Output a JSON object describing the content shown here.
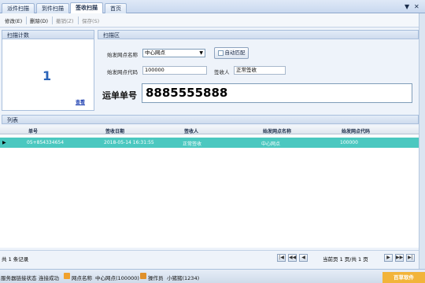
{
  "tabs": [
    {
      "label": "派件扫描"
    },
    {
      "label": "到件扫描"
    },
    {
      "label": "签收扫描"
    },
    {
      "label": "首页"
    }
  ],
  "tab_controls": {
    "down": "▼",
    "close": "✕"
  },
  "toolbar": {
    "edit": "修改(E)",
    "delete": "删除(D)",
    "undo": "撤销(Z)",
    "save": "保存(S)"
  },
  "count_panel": {
    "title": "扫描计数",
    "count": "1",
    "view_link": "查看"
  },
  "scan_panel": {
    "title": "扫描区",
    "origin_name_label": "始发网点名称",
    "origin_name_value": "中心网点",
    "origin_code_label": "始发网点代码",
    "origin_code_value": "100000",
    "auto_match_label": "自动匹配",
    "signer_label": "签收人",
    "signer_value": "正常签收",
    "waybill_label": "运单单号",
    "waybill_value": "8885555888"
  },
  "grid": {
    "title": "列表",
    "columns": [
      "单号",
      "签收日期",
      "签收人",
      "始发网点名称",
      "始发网点代码"
    ],
    "rows": [
      [
        "05+854334654",
        "2018-05-14 16:31:55",
        "正常签收",
        "中心网点",
        "100000"
      ]
    ]
  },
  "pager": {
    "total": "共 1 条记录",
    "page_info": "当前页 1 页/共 1 页"
  },
  "statusbar": {
    "server_label": "服务器链接状态",
    "server_value": "连接成功",
    "site_label": "网点名称",
    "site_value": "中心网点(100000)",
    "operator_label": "操作员",
    "operator_value": "小猪猪(1234)",
    "badge": "百草软件"
  },
  "colors": {
    "row_selected": "#4bc8c0",
    "count": "#2a63b8",
    "badge": "#f2b43a"
  }
}
